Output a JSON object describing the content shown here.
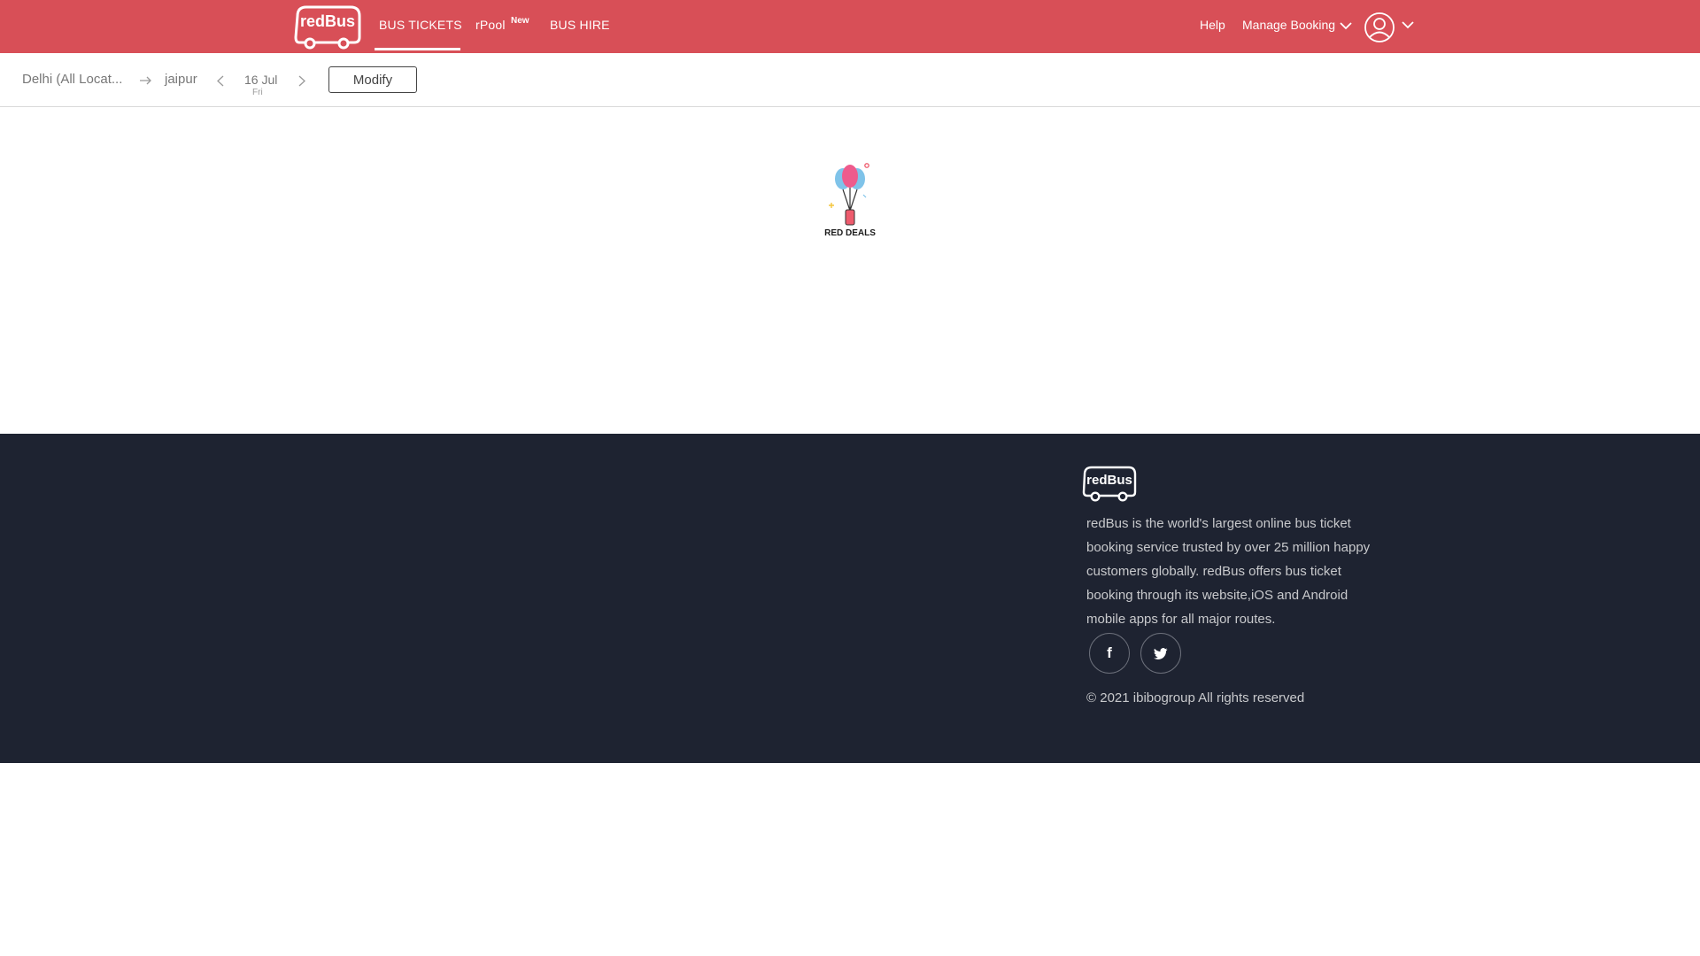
{
  "header": {
    "logo_text": "redBus",
    "nav": [
      {
        "label": "BUS TICKETS",
        "active": true
      },
      {
        "label": "rPool",
        "badge": "New"
      },
      {
        "label": "BUS HIRE"
      }
    ],
    "help": "Help",
    "manage_booking": "Manage Booking",
    "brand_color": "#d84f57"
  },
  "search": {
    "from": "Delhi (All Locat...",
    "to": "jaipur",
    "date": "16 Jul",
    "day": "Fri",
    "modify": "Modify"
  },
  "deals": {
    "label": "RED DEALS"
  },
  "footer": {
    "logo_text": "redBus",
    "about": "redBus is the world's largest online bus ticket booking service trusted by over 25 million happy customers globally. redBus offers bus ticket booking through its website,iOS and Android mobile apps for all major routes.",
    "social": [
      {
        "icon": "facebook-icon",
        "glyph": "f"
      },
      {
        "icon": "twitter-icon"
      }
    ],
    "copyright": "2021 ibibogroup All rights reserved",
    "bg_color": "#1e2331"
  }
}
